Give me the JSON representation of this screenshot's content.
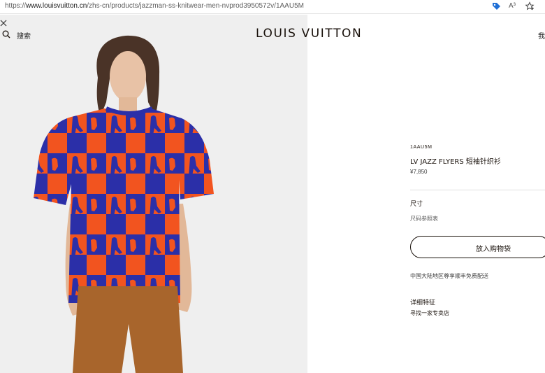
{
  "browser": {
    "url_prefix": "https://",
    "url_host": "www.louisvuitton.cn",
    "url_path": "/zhs-cn/products/jazzman-ss-knitwear-men-nvprod3950572v/1AAU5M",
    "read_aloud_label": "A³"
  },
  "header": {
    "search_label": "搜索",
    "logo_text": "LOUIS VUITTON",
    "account_label": "我"
  },
  "product": {
    "sku": "1AAU5M",
    "title": "LV JAZZ FLYERS 短袖针织衫",
    "price": "¥7,850",
    "size_label": "尺寸",
    "size_guide": "尺码参照表",
    "add_to_cart": "放入购物袋",
    "shipping_note": "中国大陆地区尊享顺丰免费配送",
    "details_label": "详细特征",
    "find_store": "寻找一家专卖店"
  },
  "colors": {
    "shirt_orange": "#f2541f",
    "shirt_blue": "#2b2fa8",
    "pants": "#a8652c",
    "text": "#19110b",
    "hero_bg": "#efefef",
    "tag_icon": "#1f6fd6"
  },
  "icons": [
    "close-icon",
    "search-icon",
    "tag-icon",
    "favorite-icon"
  ]
}
